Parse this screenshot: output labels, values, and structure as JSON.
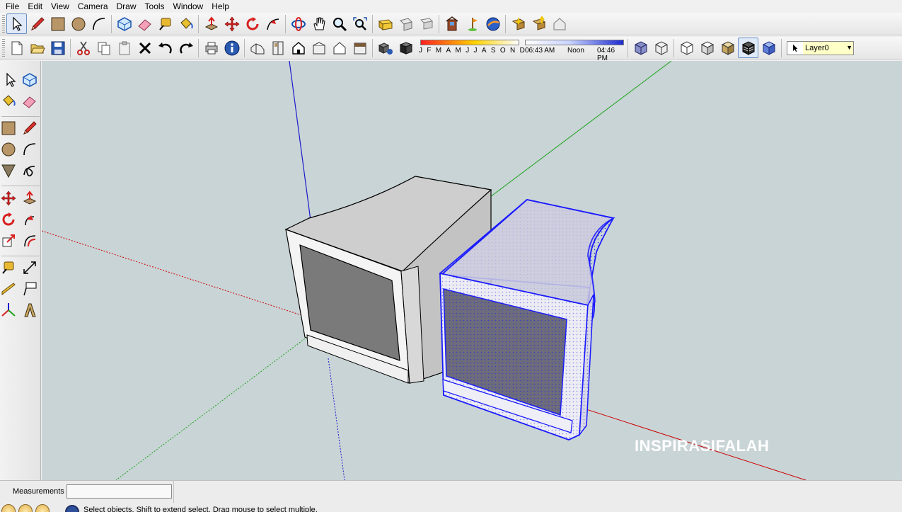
{
  "menu": [
    "File",
    "Edit",
    "View",
    "Camera",
    "Draw",
    "Tools",
    "Window",
    "Help"
  ],
  "shadow": {
    "months": [
      "J",
      "F",
      "M",
      "A",
      "M",
      "J",
      "J",
      "A",
      "S",
      "O",
      "N",
      "D"
    ],
    "time_start": "06:43 AM",
    "time_noon": "Noon",
    "time_current": "04:46 PM"
  },
  "layer": {
    "current": "Layer0"
  },
  "measurements": {
    "label": "Measurements",
    "value": ""
  },
  "status": {
    "text": "Select objects. Shift to extend select. Drag mouse to select multiple."
  },
  "watermark": "INSPIRASIFALAH",
  "colors": {
    "viewport_bg": "#c9d4d6",
    "selection": "#1a1aff",
    "axis_red": "#cc0000",
    "axis_green": "#1aa31a",
    "axis_blue": "#1a1acc"
  }
}
